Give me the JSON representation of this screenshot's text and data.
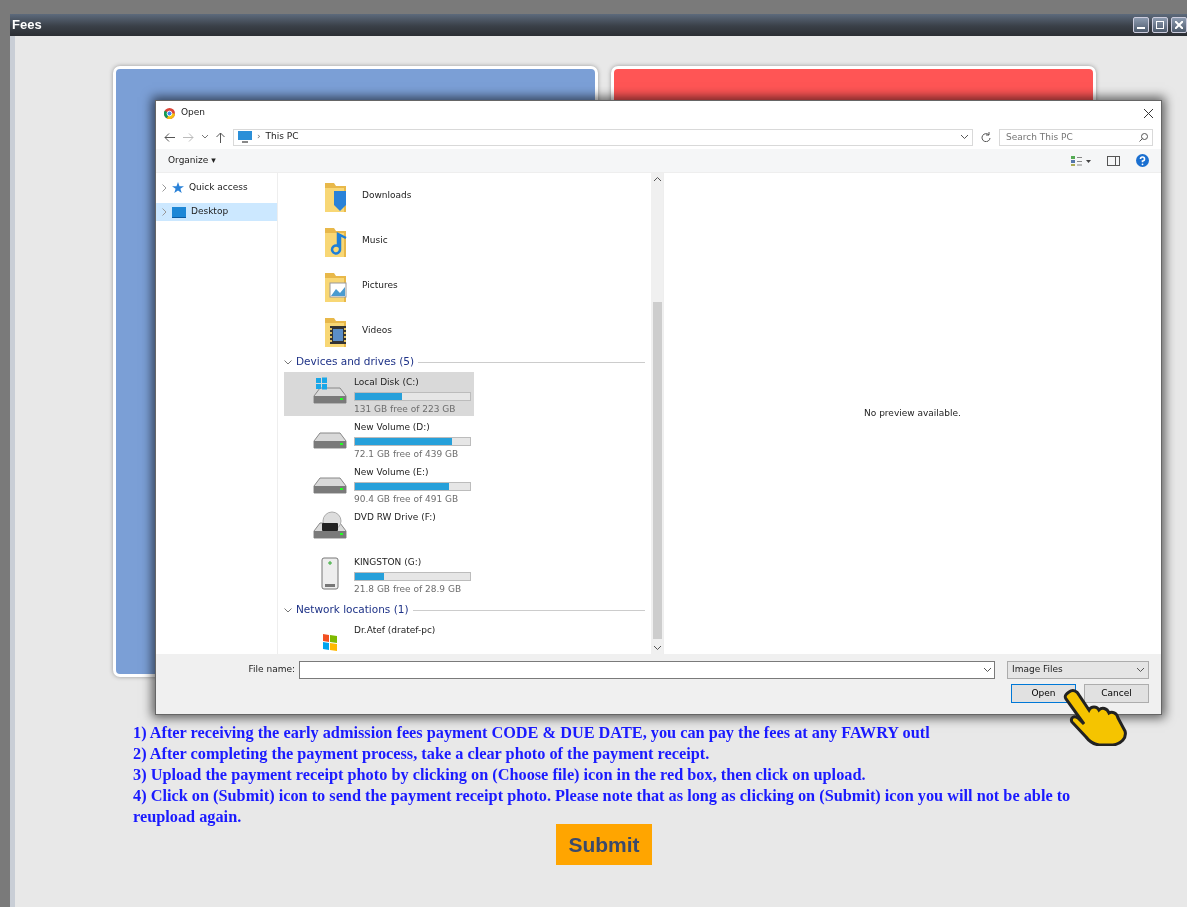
{
  "window": {
    "title": "Fees"
  },
  "dialog": {
    "title": "Open",
    "path_separator": "›",
    "path": "This PC",
    "search": {
      "placeholder": "Search This PC"
    },
    "organize": "Organize ▾",
    "nav": [
      {
        "label": "Quick access",
        "kind": "star",
        "selected": false
      },
      {
        "label": "Desktop",
        "kind": "desktop",
        "selected": true
      }
    ],
    "folders": [
      {
        "name": "Downloads",
        "kind": "downloads"
      },
      {
        "name": "Music",
        "kind": "music"
      },
      {
        "name": "Pictures",
        "kind": "pictures"
      },
      {
        "name": "Videos",
        "kind": "videos"
      }
    ],
    "groups": [
      {
        "title": "Devices and drives (5)",
        "items": [
          {
            "name": "Local Disk (C:)",
            "kind": "system",
            "level": 0.41,
            "free": "131 GB free of 223 GB",
            "selected": true
          },
          {
            "name": "New Volume (D:)",
            "kind": "disk",
            "level": 0.84,
            "free": "72.1 GB free of 439 GB",
            "selected": false
          },
          {
            "name": "New Volume (E:)",
            "kind": "disk",
            "level": 0.82,
            "free": "90.4 GB free of 491 GB",
            "selected": false
          },
          {
            "name": "DVD RW Drive (F:)",
            "kind": "dvd",
            "selected": false
          },
          {
            "name": "KINGSTON (G:)",
            "kind": "usb",
            "level": 0.25,
            "free": "21.8 GB free of 28.9 GB",
            "selected": false
          }
        ]
      },
      {
        "title": "Network locations (1)",
        "items": [
          {
            "name": "Dr.Atef (dratef-pc)",
            "kind": "network",
            "selected": false
          }
        ]
      }
    ],
    "preview": "No preview available.",
    "file_name_label": "File name:",
    "file_type": "Image Files",
    "buttons": [
      "Open",
      "Cancel"
    ]
  },
  "instructions": [
    "1) After receiving the early admission fees payment CODE & DUE DATE, you can pay the fees at any FAWRY outl",
    "2) After completing the payment process, take a clear photo of the payment receipt.",
    "3) Upload the payment receipt photo by clicking on (Choose file) icon in the red box, then click on upload.",
    "4) Click on (Submit) icon to send the payment receipt photo. Please note that as long as clicking on (Submit) icon you will not be able to reupload again."
  ],
  "submit": "Submit"
}
